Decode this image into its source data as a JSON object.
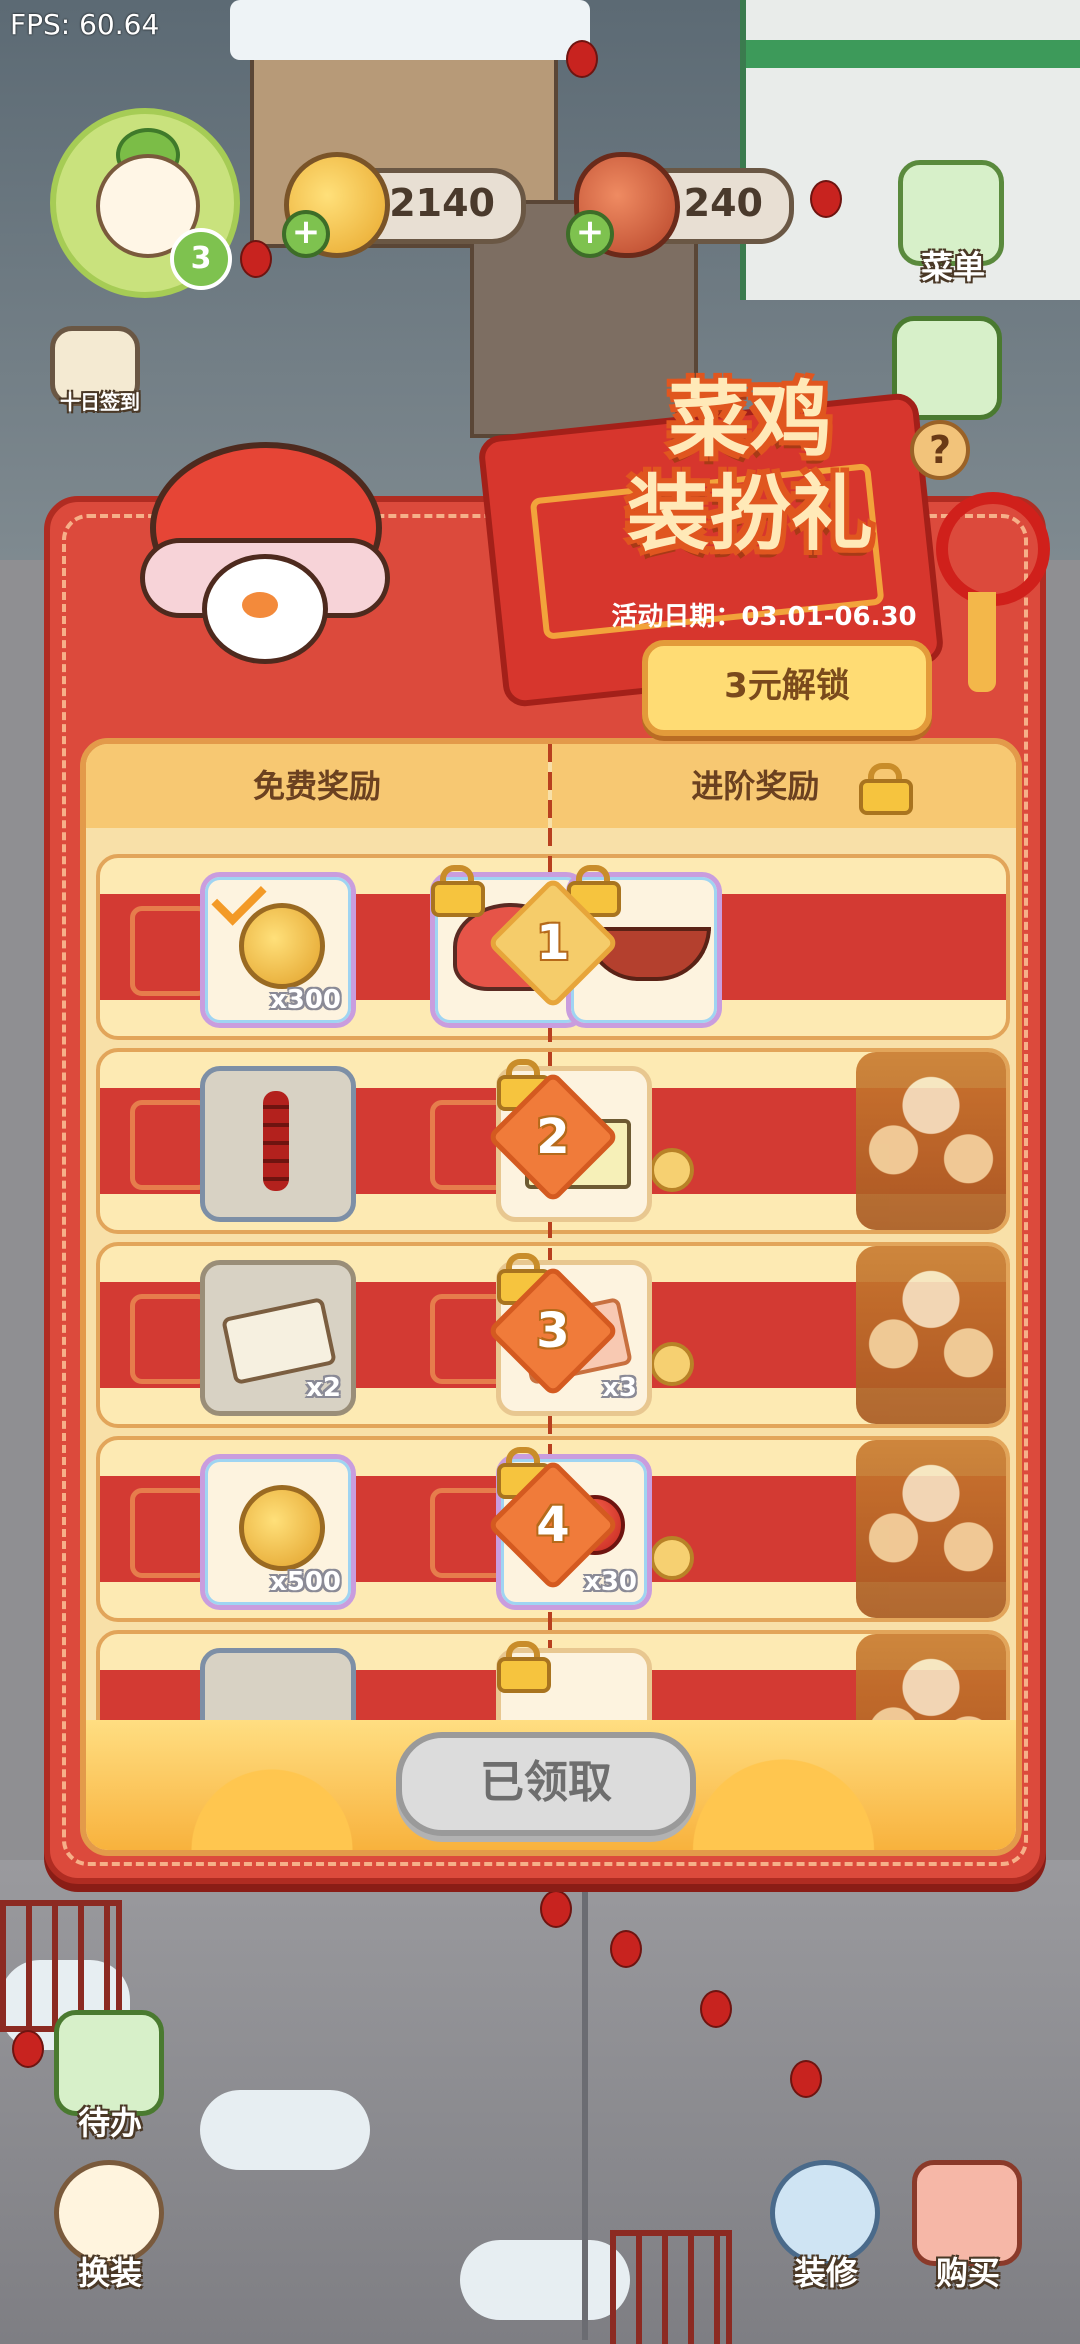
{
  "debug": {
    "fps": "FPS: 60.64"
  },
  "hud": {
    "level": "3",
    "coins": "2140",
    "meat": "240",
    "menu_label": "菜单",
    "checkin_label": "十日签到",
    "todo_label": "待办",
    "dressup_label": "换装",
    "decorate_label": "装修",
    "shop_label": "购买"
  },
  "event": {
    "title_line1": "菜鸡",
    "title_line2": "装扮礼",
    "date_text": "活动日期：03.01-06.30",
    "help": "?",
    "unlock_button": "3元解锁",
    "free_header": "免费奖励",
    "premium_header": "进阶奖励",
    "claimed_button": "已领取"
  },
  "rewards": [
    {
      "level": "1",
      "free": {
        "icon": "gold-coin-icon",
        "qty": "x300",
        "claimed": true
      },
      "premium": [
        {
          "icon": "lion-hat-icon",
          "qty": ""
        },
        {
          "icon": "dragon-boat-icon",
          "qty": ""
        }
      ]
    },
    {
      "level": "2",
      "free": {
        "icon": "red-knot-icon",
        "qty": ""
      },
      "premium": [
        {
          "icon": "tofu-bed-icon",
          "qty": ""
        }
      ]
    },
    {
      "level": "3",
      "free": {
        "icon": "ticket-icon",
        "qty": "x2"
      },
      "premium": [
        {
          "icon": "double-ticket-icon",
          "qty": "x3"
        }
      ]
    },
    {
      "level": "4",
      "free": {
        "icon": "gold-coin-icon",
        "qty": "x500"
      },
      "premium": [
        {
          "icon": "cherry-icon",
          "qty": "x30"
        }
      ]
    }
  ],
  "colors": {
    "modal_red": "#dc4a3c",
    "panel_cream": "#f8e0a8",
    "accent_orange": "#f07b3a",
    "gold": "#f5cc6a"
  }
}
